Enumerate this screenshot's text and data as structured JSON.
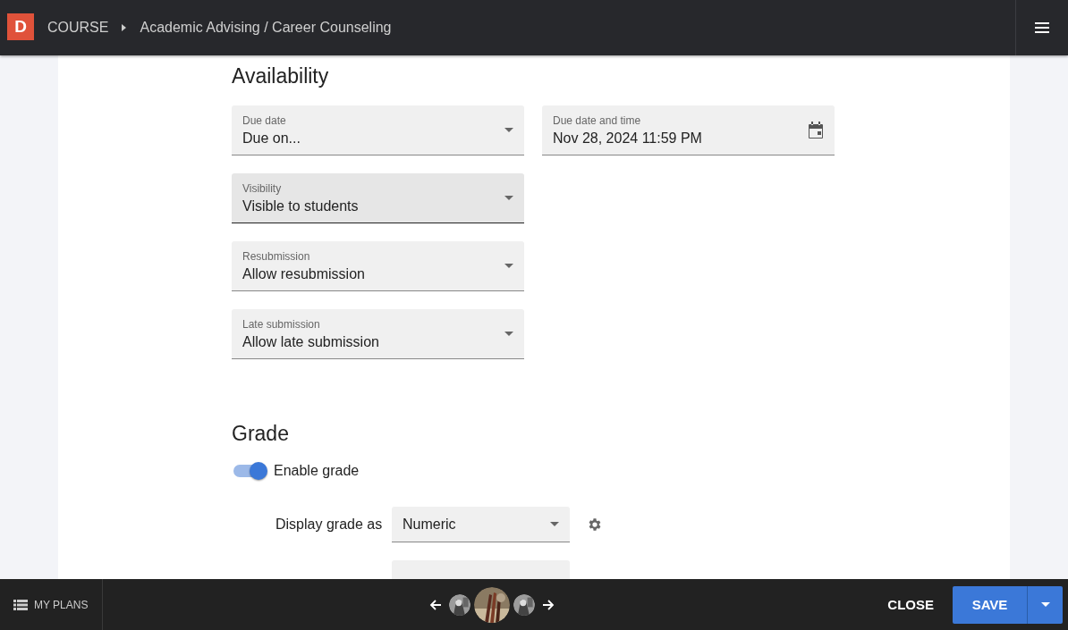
{
  "header": {
    "logo": "D",
    "breadcrumb": [
      "COURSE",
      "Academic Advising / Career Counseling"
    ]
  },
  "availability": {
    "title": "Availability",
    "rows": [
      [
        {
          "label": "Due date",
          "value": "Due on...",
          "kind": "select",
          "focused": false
        },
        {
          "label": "Due date and time",
          "value": "Nov 28, 2024 11:59 PM",
          "kind": "date",
          "focused": false
        }
      ],
      [
        {
          "label": "Visibility",
          "value": "Visible to students",
          "kind": "select",
          "focused": true
        }
      ],
      [
        {
          "label": "Resubmission",
          "value": "Allow resubmission",
          "kind": "select",
          "focused": false
        }
      ],
      [
        {
          "label": "Late submission",
          "value": "Allow late submission",
          "kind": "select",
          "focused": false
        }
      ]
    ]
  },
  "grade": {
    "title": "Grade",
    "toggle": {
      "label": "Enable grade",
      "on": true
    },
    "rows": [
      {
        "label": "Display grade as",
        "value": "Numeric",
        "kind": "select"
      },
      {
        "kind": "cut"
      }
    ]
  },
  "footer": {
    "plans": "MY PLANS",
    "thumbnails": [
      {
        "kind": "picture",
        "selected": false
      },
      {
        "kind": "picture",
        "selected": true
      },
      {
        "kind": "picture",
        "selected": false
      }
    ],
    "close": "CLOSE",
    "save": "SAVE"
  }
}
